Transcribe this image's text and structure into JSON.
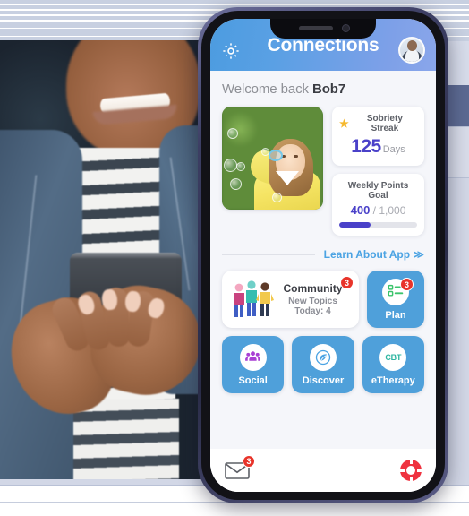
{
  "app": {
    "header": {
      "title": "Connections",
      "settings_icon": "gear-icon",
      "avatar_icon": "user-avatar"
    },
    "welcome": {
      "greeting": "Welcome back ",
      "username": "Bob7"
    },
    "hero_photo": {
      "alt": "child blowing bubbles outdoors"
    },
    "stats": {
      "sobriety": {
        "label": "Sobriety Streak",
        "icon": "star-icon",
        "value": "125",
        "unit": "Days"
      },
      "weekly_points": {
        "label": "Weekly Points Goal",
        "current": "400",
        "separator": " / ",
        "target": "1,000",
        "progress_percent": 40,
        "bar_color": "#4a41c9"
      }
    },
    "learn_link": "Learn About App ≫",
    "tiles": {
      "community": {
        "title": "Community",
        "subtitle": "New Topics Today: 4",
        "badge": "3",
        "icon": "community-people-icon"
      },
      "plan": {
        "label": "Plan",
        "badge": "3",
        "icon": "checklist-icon"
      },
      "social": {
        "label": "Social",
        "icon": "people-group-icon"
      },
      "discover": {
        "label": "Discover",
        "icon": "compass-leaf-icon"
      },
      "etherapy": {
        "label": "eTherapy",
        "icon": "cbt-icon",
        "icon_text": "CBT"
      }
    },
    "bottom_bar": {
      "messages": {
        "icon": "envelope-icon",
        "badge": "3"
      },
      "help": {
        "icon": "life-ring-icon"
      }
    },
    "colors": {
      "header_start": "#4c9ce0",
      "header_end": "#8aa6ea",
      "tile_blue": "#4fa0da",
      "accent_purple": "#4a41c9",
      "link_blue": "#4ba3e3",
      "badge_red": "#e8342a",
      "help_red": "#ef3340",
      "screen_bg": "#f5f6fa"
    }
  },
  "scene": {
    "left_photo_alt": "person in denim jacket holding a smartphone",
    "backdrop_colors": {
      "light": "#d7dcea",
      "slate_band": "#5c6a92",
      "top_band": "#c8d0e1"
    }
  }
}
